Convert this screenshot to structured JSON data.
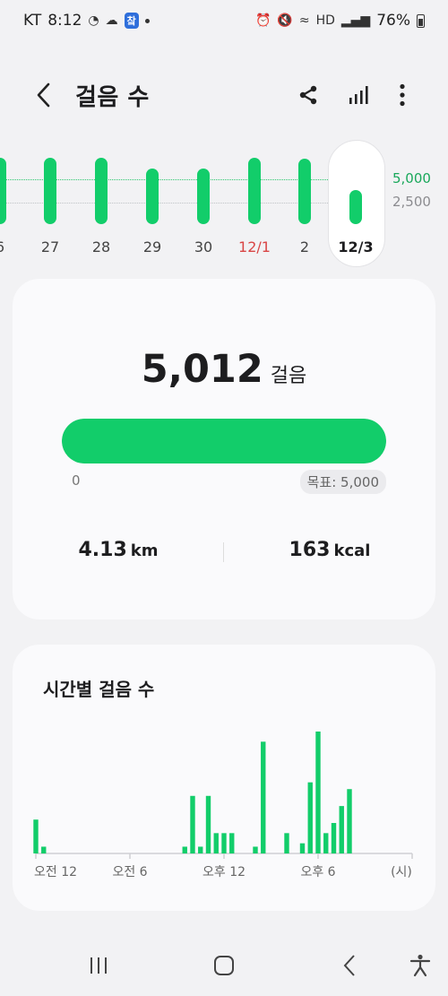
{
  "status_bar": {
    "carrier": "KT",
    "time": "8:12",
    "battery": "76%",
    "notification_badge": "챀"
  },
  "header": {
    "title": "걸음 수"
  },
  "weekly": {
    "days": [
      "6",
      "27",
      "28",
      "29",
      "30",
      "12/1",
      "2",
      "12/3"
    ],
    "sunday_label": "12/1",
    "selected_label": "12/3",
    "steps": [
      7300,
      7300,
      7300,
      6100,
      6100,
      7300,
      7200,
      5012
    ],
    "goal_line_label": "5,000",
    "mid_line_label": "2,500"
  },
  "summary": {
    "steps_value": "5,012",
    "steps_unit": "걸음",
    "goal": 5000,
    "steps_number": 5012,
    "progress_min_label": "0",
    "goal_label": "목표: 5,000",
    "distance_value": "4.13",
    "distance_unit": "km",
    "calories_value": "163",
    "calories_unit": "kcal"
  },
  "hourly": {
    "title": "시간별 걸음 수",
    "x_labels": [
      "오전 12",
      "오전 6",
      "오후 12",
      "오후 6"
    ],
    "x_unit": "(시)"
  },
  "chart_data": {
    "type": "bar",
    "title": "시간별 걸음 수",
    "xlabel": "(시)",
    "tick_labels": [
      "오전 12",
      "오전 6",
      "오후 12",
      "오후 6"
    ],
    "x_range_hours": [
      0,
      24
    ],
    "x": [
      0,
      0.5,
      9.5,
      10,
      10.5,
      11,
      11.5,
      12,
      12.5,
      14,
      14.5,
      16,
      17,
      17.5,
      18,
      18.5,
      19,
      19.5,
      20
    ],
    "values": [
      100,
      20,
      20,
      170,
      20,
      170,
      60,
      60,
      60,
      20,
      330,
      60,
      30,
      210,
      360,
      60,
      90,
      140,
      190
    ]
  },
  "colors": {
    "accent": "#12cd6a",
    "sunday": "#d94545",
    "track": "#e5e5e7",
    "background": "#f2f2f4",
    "card": "#fafafc"
  },
  "icons": {
    "back": "chevron-left-icon",
    "share": "share-icon",
    "stats": "bar-chart-icon",
    "more": "more-vertical-icon",
    "nav_recent": "recent-apps-icon",
    "nav_home": "home-icon",
    "nav_back": "back-icon",
    "nav_accessibility": "accessibility-icon"
  }
}
